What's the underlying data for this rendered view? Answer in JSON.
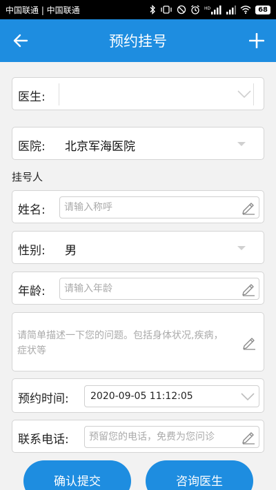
{
  "status_bar": {
    "carrier": "中国联通 | 中国联通",
    "battery": "68"
  },
  "header": {
    "title": "预约挂号"
  },
  "form": {
    "doctor": {
      "label": "医生:",
      "value": ""
    },
    "hospital": {
      "label": "医院:",
      "value": "北京军海医院"
    },
    "section_registrant": "挂号人",
    "name": {
      "label": "姓名:",
      "placeholder": "请输入称呼"
    },
    "gender": {
      "label": "性别:",
      "value": "男"
    },
    "age": {
      "label": "年龄:",
      "placeholder": "请输入年龄"
    },
    "description": {
      "placeholder": "请简单描述一下您的问题。包括身体状况,疾病，症状等"
    },
    "appointment_time": {
      "label": "预约时间:",
      "value": "2020-09-05 11:12:05"
    },
    "phone": {
      "label": "联系电话:",
      "placeholder": "预留您的电话，免费为您问诊"
    }
  },
  "buttons": {
    "submit": "确认提交",
    "consult": "咨询医生"
  },
  "colors": {
    "primary": "#1e8de0",
    "background": "#f2f2f2"
  }
}
